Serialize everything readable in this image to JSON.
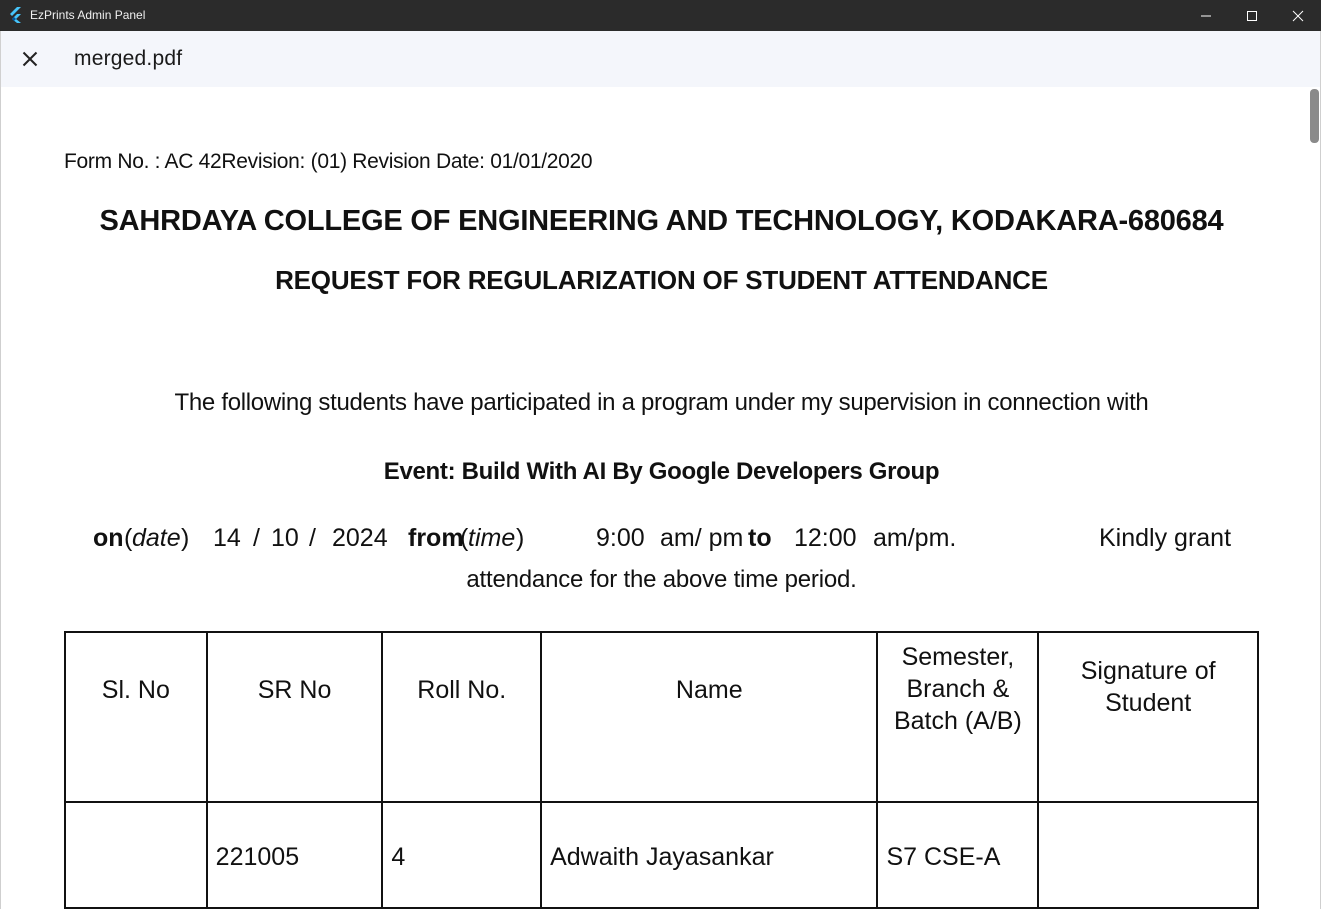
{
  "window": {
    "title": "EzPrints Admin Panel",
    "logo_icon": "flutter-logo-icon",
    "accent": "#2b2b2b"
  },
  "viewer": {
    "file_name": "merged.pdf",
    "close_icon": "close-icon"
  },
  "document": {
    "form_meta": "Form No. : AC 42Revision:  (01) Revision Date: 01/01/2020",
    "college": "SAHRDAYA COLLEGE OF ENGINEERING AND TECHNOLOGY, KODAKARA-680684",
    "request_title": "REQUEST FOR REGULARIZATION OF STUDENT ATTENDANCE",
    "intro": "The following students have participated in a program under my supervision in connection with",
    "event": "Event: Build With AI By Google Developers Group",
    "on_label": "on",
    "date_label": "date",
    "date_day": "14",
    "date_sep1": "/",
    "date_month": "10",
    "date_sep2": "/",
    "date_year": "2024",
    "from_label": "from",
    "time_label": "time",
    "from_time": "9:00",
    "from_suffix": "am/ pm",
    "to_label": "to",
    "to_time": "12:00",
    "to_suffix": "am/pm.",
    "kindly": "Kindly grant",
    "attendance": "attendance for the above time period."
  },
  "table": {
    "headers": {
      "sl_no": "Sl. No",
      "sr_no": "SR No",
      "roll_no": "Roll No.",
      "name": "Name",
      "semester_1": "Semester,",
      "semester_2": "Branch &",
      "semester_3": "Batch (A/B)",
      "signature_1": "Signature of",
      "signature_2": "Student"
    },
    "rows": [
      {
        "sl_no": "",
        "sr_no": "221005",
        "roll_no": "4",
        "name": "Adwaith Jayasankar",
        "semester": "S7 CSE-A",
        "signature": ""
      }
    ]
  }
}
